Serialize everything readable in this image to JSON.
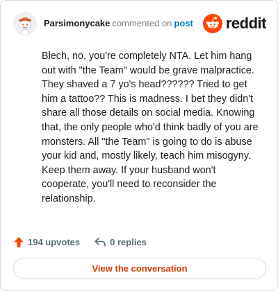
{
  "header": {
    "username": "Parsimonycake",
    "action": "commented on",
    "target_link": "post",
    "brand": "reddit",
    "avatar_icon": "snoo-avatar-icon",
    "brand_icon": "reddit-logo-icon"
  },
  "comment": {
    "text": "Blech, no, you're completely NTA. Let him hang out with \"the Team\" would be grave malpractice. They shaved a 7 yo's head?????? Tried to get him a tattoo?? This is madness. I bet they didn't share all those details on social media. Knowing that, the only people who'd think badly of you are monsters. All \"the Team\" is going to do is abuse your kid and, mostly likely, teach him misogyny. Keep them away. If your husband won't cooperate, you'll need to reconsider the relationship."
  },
  "stats": {
    "upvotes": "194 upvotes",
    "replies": "0 replies",
    "upvote_icon": "upvote-arrow-icon",
    "reply_icon": "reply-arrow-icon"
  },
  "actions": {
    "view_conversation": "View the conversation"
  },
  "colors": {
    "brand": "#ff4500",
    "link": "#0079d3",
    "cta_text": "#d93a00",
    "muted": "#576f76"
  }
}
